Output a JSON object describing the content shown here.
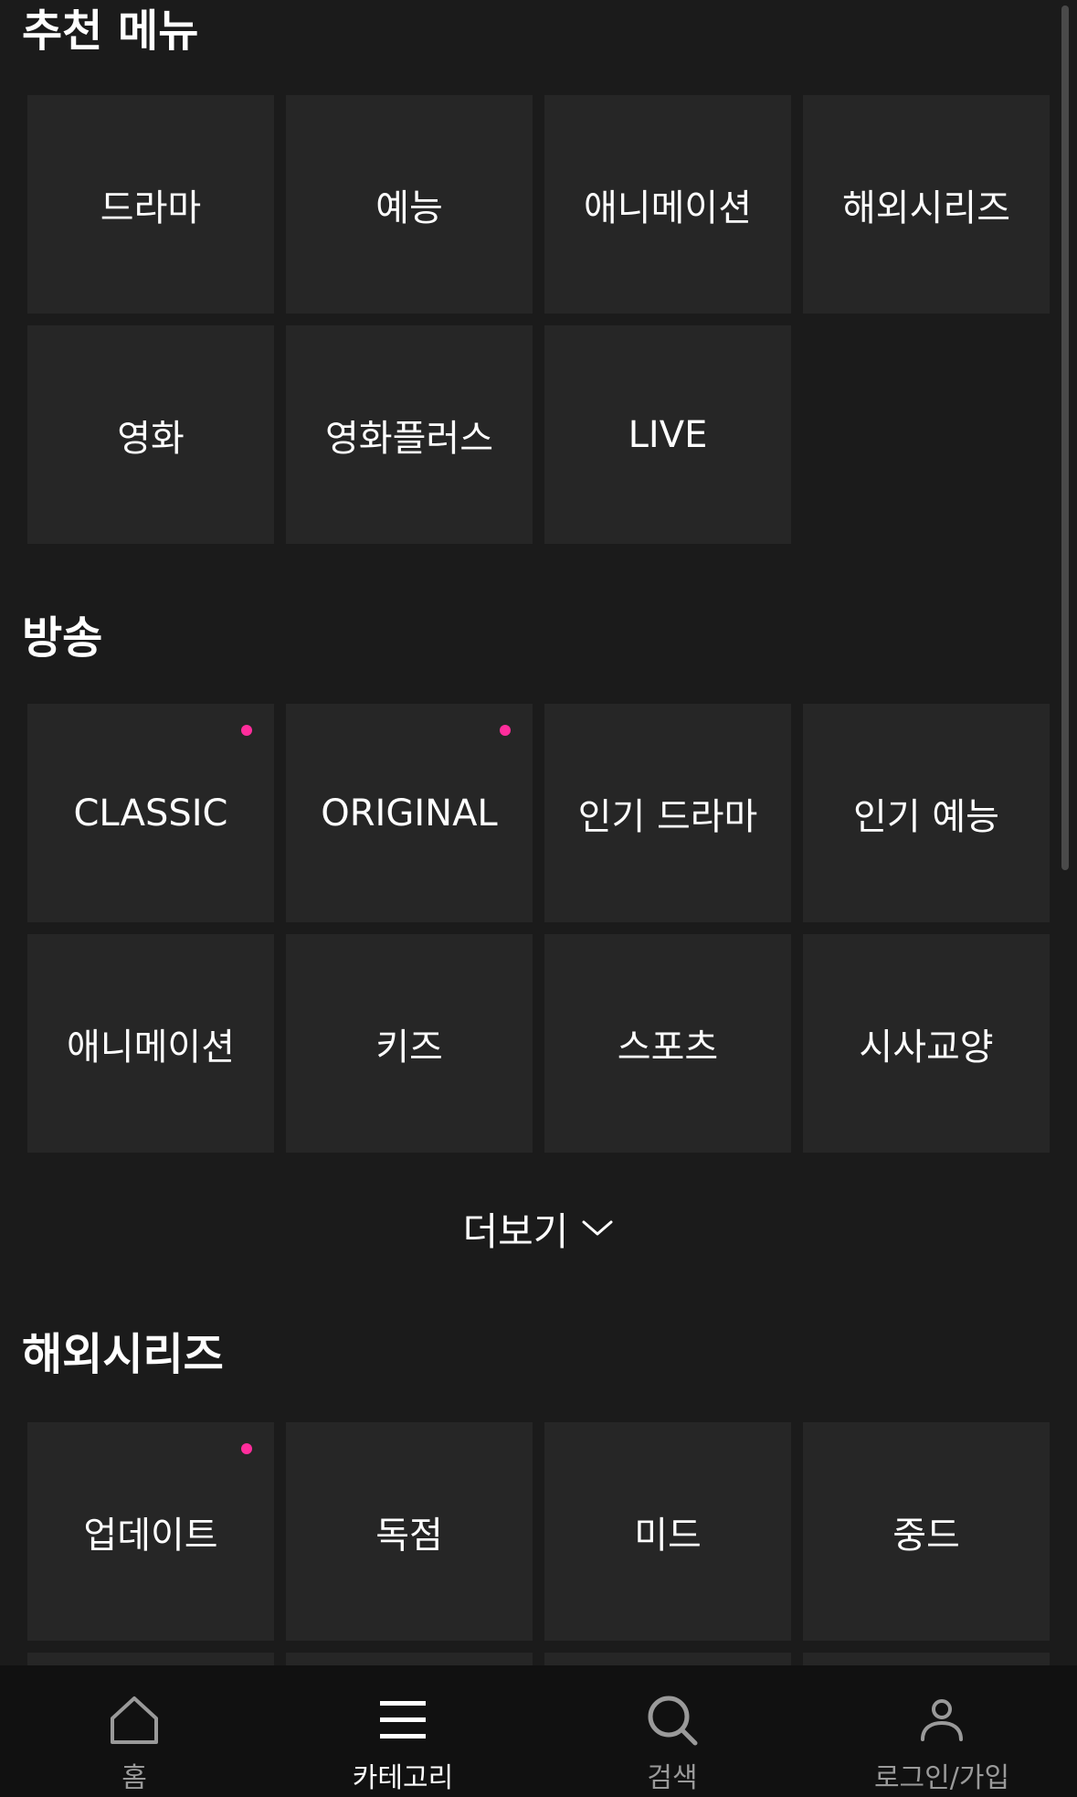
{
  "sections": {
    "recommended": {
      "title": "추천 메뉴",
      "items": [
        "드라마",
        "예능",
        "애니메이션",
        "해외시리즈",
        "영화",
        "영화플러스",
        "LIVE"
      ]
    },
    "broadcast": {
      "title": "방송",
      "items": [
        "CLASSIC",
        "ORIGINAL",
        "인기 드라마",
        "인기 예능",
        "애니메이션",
        "키즈",
        "스포츠",
        "시사교양"
      ],
      "more_label": "더보기"
    },
    "overseas": {
      "title": "해외시리즈",
      "items": [
        "업데이트",
        "독점",
        "미드",
        "중드"
      ]
    }
  },
  "colors": {
    "background": "#1b1b1b",
    "tile": "#262626",
    "new_dot": "#ff2d9c",
    "nav_background": "#111111"
  },
  "bottom_nav": {
    "items": [
      {
        "label": "홈",
        "icon": "home-icon",
        "active": false
      },
      {
        "label": "카테고리",
        "icon": "menu-icon",
        "active": true
      },
      {
        "label": "검색",
        "icon": "search-icon",
        "active": false
      },
      {
        "label": "로그인/가입",
        "icon": "user-icon",
        "active": false
      }
    ]
  }
}
